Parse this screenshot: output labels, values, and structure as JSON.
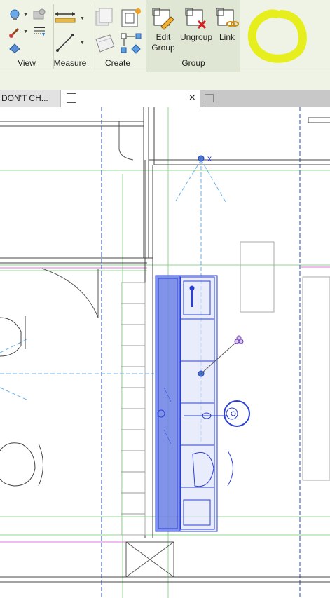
{
  "ribbon": {
    "panels": {
      "view": "View",
      "measure": "Measure",
      "create": "Create",
      "group": "Group"
    },
    "buttons": {
      "edit_group": [
        "Edit",
        "Group"
      ],
      "ungroup": "Ungroup",
      "link": "Link"
    }
  },
  "tabs": {
    "tab1": "DON'T CH...",
    "close_glyph": "×"
  },
  "canvas": {
    "annotation_x": "x"
  },
  "colors": {
    "ribbon_bg": "#eef3e6",
    "selection_blue": "#2b3fd6",
    "highlight_yellow": "#e6ee1e",
    "grid_green": "#7fd37f"
  }
}
